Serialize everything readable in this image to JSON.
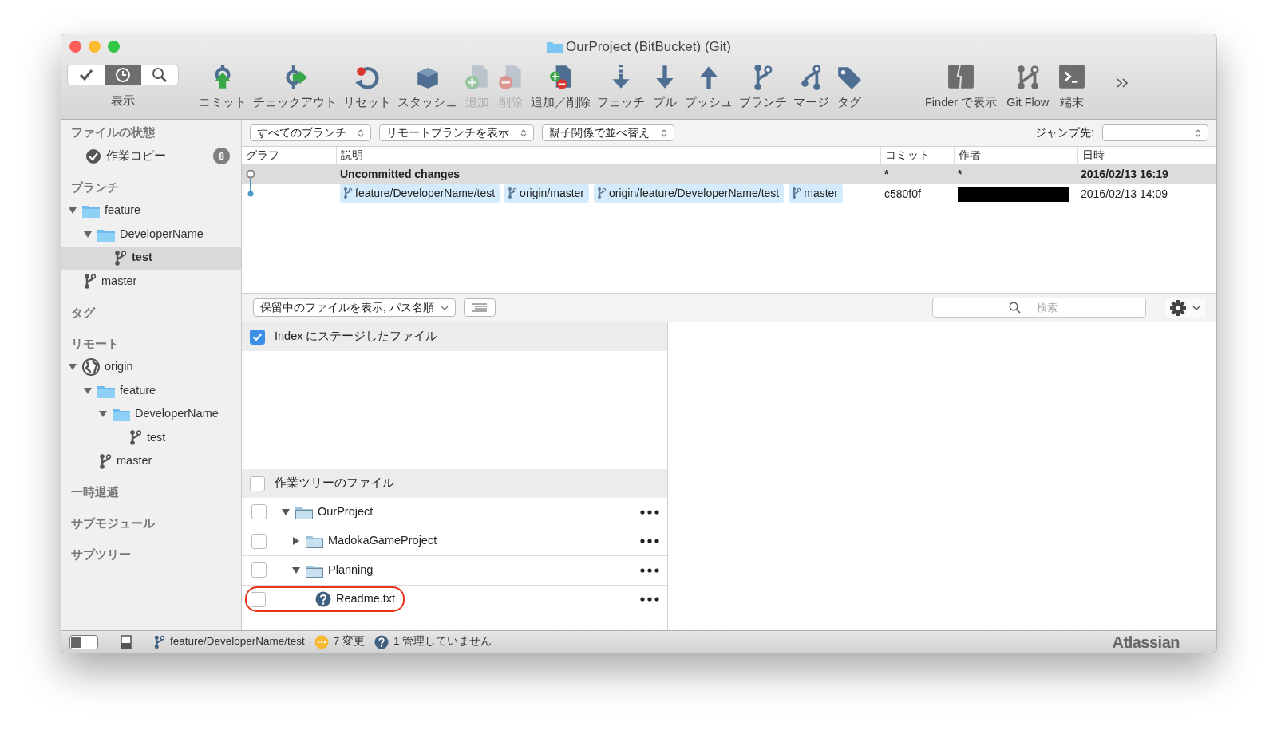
{
  "window": {
    "title": "OurProject (BitBucket) (Git)"
  },
  "toolbar": {
    "view": {
      "label": "表示",
      "segments": [
        {
          "kind": "check",
          "selected": false
        },
        {
          "kind": "clock",
          "selected": true
        },
        {
          "kind": "search",
          "selected": false
        }
      ]
    },
    "buttons": [
      {
        "kind": "commit",
        "label": "コミット",
        "disabled": false
      },
      {
        "kind": "checkout",
        "label": "チェックアウト",
        "disabled": false
      },
      {
        "kind": "reset",
        "label": "リセット",
        "disabled": false
      },
      {
        "kind": "stash",
        "label": "スタッシュ",
        "disabled": false
      },
      {
        "kind": "add",
        "label": "追加",
        "disabled": true
      },
      {
        "kind": "remove",
        "label": "削除",
        "disabled": true
      },
      {
        "kind": "addremove",
        "label": "追加／削除",
        "disabled": false
      },
      {
        "kind": "fetch",
        "label": "フェッチ",
        "disabled": false
      },
      {
        "kind": "pull",
        "label": "プル",
        "disabled": false
      },
      {
        "kind": "push",
        "label": "プッシュ",
        "disabled": false
      },
      {
        "kind": "branch",
        "label": "ブランチ",
        "disabled": false
      },
      {
        "kind": "merge",
        "label": "マージ",
        "disabled": false
      },
      {
        "kind": "tag",
        "label": "タグ",
        "disabled": false
      }
    ],
    "tools": [
      {
        "kind": "finder",
        "label": "Finder で表示"
      },
      {
        "kind": "gitflow",
        "label": "Git Flow"
      },
      {
        "kind": "terminal",
        "label": "端末"
      }
    ]
  },
  "sidebar": {
    "sections": [
      {
        "heading": "ファイルの状態",
        "items": [
          {
            "kind": "check-circle",
            "label": "作業コピー",
            "badge": "8",
            "selected": false
          }
        ]
      },
      {
        "heading": "ブランチ",
        "items": [
          {
            "kind": "folder",
            "label": "feature",
            "selected": false,
            "expanded": true,
            "children": [
              {
                "kind": "folder",
                "label": "DeveloperName",
                "selected": false,
                "expanded": true,
                "children": [
                  {
                    "kind": "branch",
                    "label": "test",
                    "selected": true
                  }
                ]
              }
            ]
          },
          {
            "kind": "branch",
            "label": "master",
            "selected": false
          }
        ]
      },
      {
        "heading": "タグ"
      },
      {
        "heading": "リモート",
        "items": [
          {
            "kind": "globe",
            "label": "origin",
            "selected": false,
            "expanded": true,
            "children": [
              {
                "kind": "folder",
                "label": "feature",
                "selected": false,
                "expanded": true,
                "children": [
                  {
                    "kind": "folder",
                    "label": "DeveloperName",
                    "selected": false,
                    "expanded": true,
                    "children": [
                      {
                        "kind": "branch",
                        "label": "test",
                        "selected": false
                      }
                    ]
                  }
                ]
              },
              {
                "kind": "branch",
                "label": "master",
                "selected": false
              }
            ]
          }
        ]
      },
      {
        "heading": "一時退避"
      },
      {
        "heading": "サブモジュール"
      },
      {
        "heading": "サブツリー"
      }
    ]
  },
  "filters": [
    {
      "label": "すべてのブランチ"
    },
    {
      "label": "リモートブランチを表示"
    },
    {
      "label": "親子関係で並べ替え"
    }
  ],
  "jump": {
    "label": "ジャンプ先:"
  },
  "commits": {
    "columns": [
      "グラフ",
      "説明",
      "コミット",
      "作者",
      "日時"
    ],
    "rows": [
      {
        "kind": "uncommitted",
        "description": "Uncommitted changes",
        "commit": "*",
        "author": "*",
        "date": "2016/02/13 16:19"
      },
      {
        "kind": "commit",
        "tags": [
          "feature/DeveloperName/test",
          "origin/master",
          "origin/feature/DeveloperName/test",
          "master"
        ],
        "commit": "c580f0f",
        "redacted": true,
        "date": "2016/02/13 14:09"
      }
    ]
  },
  "files": {
    "view": {
      "label": "保留中のファイルを表示, パス名順"
    },
    "search": {
      "placeholder": "検索"
    },
    "staged": {
      "label": "Index にステージしたファイル",
      "checked": true
    },
    "working": {
      "label": "作業ツリーのファイル",
      "checked": false,
      "tree": [
        {
          "kind": "folder",
          "label": "OurProject",
          "checked": false,
          "expanded": true,
          "children": [
            {
              "kind": "folder",
              "label": "MadokaGameProject",
              "checked": false,
              "expanded": false
            },
            {
              "kind": "folder",
              "label": "Planning",
              "checked": false,
              "expanded": true,
              "children": [
                {
                  "kind": "unknown-file",
                  "label": "Readme.txt",
                  "checked": false,
                  "highlighted": true
                }
              ]
            }
          ]
        }
      ]
    }
  },
  "status_bar": {
    "branch": "feature/DeveloperName/test",
    "changes": "7 変更",
    "untracked": "1 管理していません",
    "brand": "Atlassian"
  }
}
